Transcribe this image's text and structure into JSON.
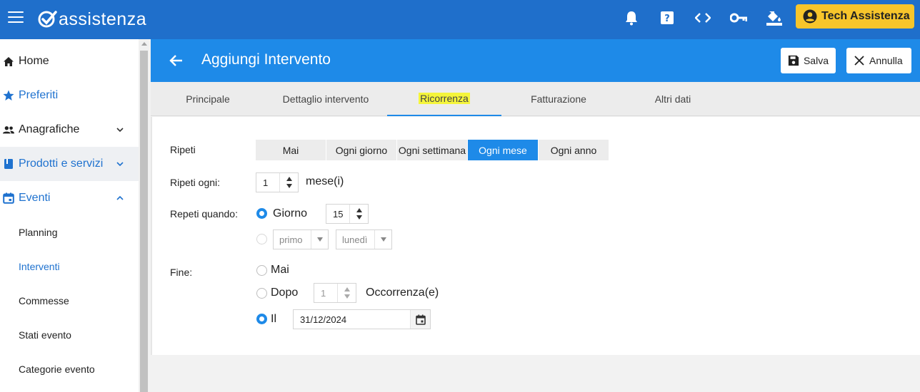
{
  "topbar": {
    "brand": "assistenza",
    "icons": [
      "bell-icon",
      "help-icon",
      "code-icon",
      "key-icon",
      "paint-bucket-icon"
    ],
    "user_name": "Tech Assistenza",
    "colors": {
      "bar": "#1f6fcb",
      "user_button": "#f7c52b"
    }
  },
  "sidebar": {
    "items": [
      {
        "label": "Home",
        "icon": "home-icon"
      },
      {
        "label": "Preferiti",
        "icon": "star-icon"
      },
      {
        "label": "Anagrafiche",
        "icon": "people-icon"
      },
      {
        "label": "Prodotti e servizi",
        "icon": "book-icon"
      },
      {
        "label": "Eventi",
        "icon": "calendar-icon"
      }
    ],
    "subitems": [
      "Planning",
      "Interventi",
      "Commesse",
      "Stati evento",
      "Categorie evento"
    ]
  },
  "header": {
    "title": "Aggiungi Intervento",
    "save_label": "Salva",
    "cancel_label": "Annulla"
  },
  "tabs": [
    "Principale",
    "Dettaglio intervento",
    "Ricorrenza",
    "Fatturazione",
    "Altri dati"
  ],
  "active_tab": "Ricorrenza",
  "form": {
    "repeat_label": "Ripeti",
    "repeat_options": [
      "Mai",
      "Ogni giorno",
      "Ogni settimana",
      "Ogni mese",
      "Ogni anno"
    ],
    "repeat_selected": "Ogni mese",
    "repeat_every_label": "Ripeti ogni:",
    "repeat_every_value": "1",
    "repeat_every_unit": "mese(i)",
    "repeat_when_label": "Repeti quando:",
    "day_option_label": "Giorno",
    "day_value": "15",
    "ordinal_value": "primo",
    "weekday_value": "lunedì",
    "end_label": "Fine:",
    "end_never_label": "Mai",
    "end_after_label": "Dopo",
    "end_after_value": "1",
    "end_after_unit": "Occorrenza(e)",
    "end_on_label": "Il",
    "end_date_value": "31/12/2024"
  }
}
